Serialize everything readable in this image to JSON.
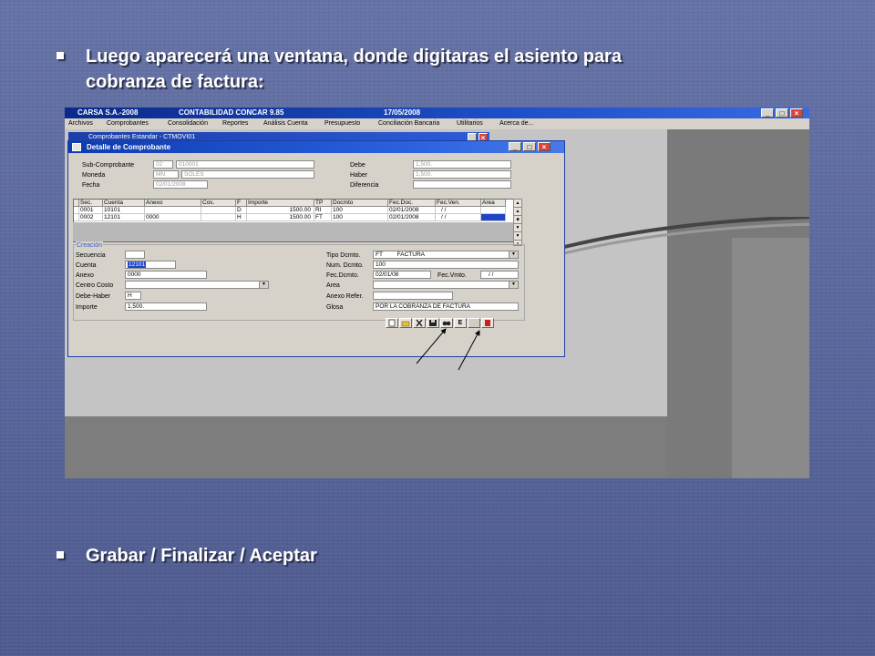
{
  "slide": {
    "bullet1_line1": "Luego aparecerá una ventana, donde digitaras el asiento para",
    "bullet1_line2": "cobranza de factura:",
    "bullet2": "Grabar / Finalizar / Aceptar"
  },
  "app": {
    "title_company": "CARSA S.A.-2008",
    "title_product": "CONTABILIDAD CONCAR 9.85",
    "title_date": "17/05/2008",
    "menu": [
      "Archivos",
      "Comprobantes",
      "Consolidación",
      "Reportes",
      "Análisis Cuenta",
      "Presupuesto",
      "Conciliación Bancaria",
      "Utilitarios",
      "Acerca de..."
    ]
  },
  "bg_window": {
    "title": "Comprobantes Estandar - CTMOVI01"
  },
  "detail": {
    "title": "Detalle de Comprobante",
    "labels": {
      "subcomprobante": "Sub-Comprobante",
      "moneda": "Moneda",
      "fecha": "Fecha",
      "debe": "Debe",
      "haber": "Haber",
      "diferencia": "Diferencia"
    },
    "values": {
      "sub_code": "02",
      "sub_num": "010001",
      "moneda_code": "MN",
      "moneda_name": "SOLES",
      "fecha": "02/01/2008",
      "debe": "1,500.",
      "haber": "1,500.",
      "diferencia": ""
    },
    "grid": {
      "headers": [
        "Sec.",
        "Cuenta",
        "Anexo",
        "Cos.",
        "F",
        "Importe",
        "TP",
        "Docmto",
        "Fec.Doc.",
        "Fec.Ven.",
        "Area"
      ],
      "rows": [
        [
          "0001",
          "10101",
          "",
          "",
          "D",
          "1500.00",
          "RI",
          "100",
          "02/01/2008",
          "/ /",
          ""
        ],
        [
          "0002",
          "12101",
          "0000",
          "",
          "H",
          "1500.00",
          "FT",
          "100",
          "02/01/2008",
          "/ /",
          ""
        ]
      ]
    },
    "section_title": "Creación",
    "form": {
      "secuencia_label": "Secuencia",
      "secuencia": "",
      "cuenta_label": "Cuenta",
      "cuenta": "12101",
      "anexo_label": "Anexo",
      "anexo": "0000",
      "centro_label": "Centro Costo",
      "centro": "",
      "debehaber_label": "Debe-Haber",
      "debehaber": "H",
      "importe_label": "Importe",
      "importe": "1,500.",
      "tipodoc_label": "Tipo Dcmto.",
      "tipodoc_code": "FT",
      "tipodoc_name": "FACTURA",
      "numdoc_label": "Num. Dcmto.",
      "numdoc": "100",
      "fecdoc_label": "Fec.Dcmto.",
      "fecdoc": "02/01/08",
      "fecvmto_label": "Fec.Vmto.",
      "fecvmto": "/ /",
      "area_label": "Area",
      "area": "",
      "anexoref_label": "Anexo Refer.",
      "anexoref": "",
      "glosa_label": "Glosa",
      "glosa": "POR LA COBRANZA DE FACTURA"
    },
    "toolbar": {
      "finish_label": "E"
    }
  },
  "colors": {
    "slide_bg": "#5d6a9c",
    "titlebar": "#1e4fc8",
    "close": "#d9453b"
  }
}
